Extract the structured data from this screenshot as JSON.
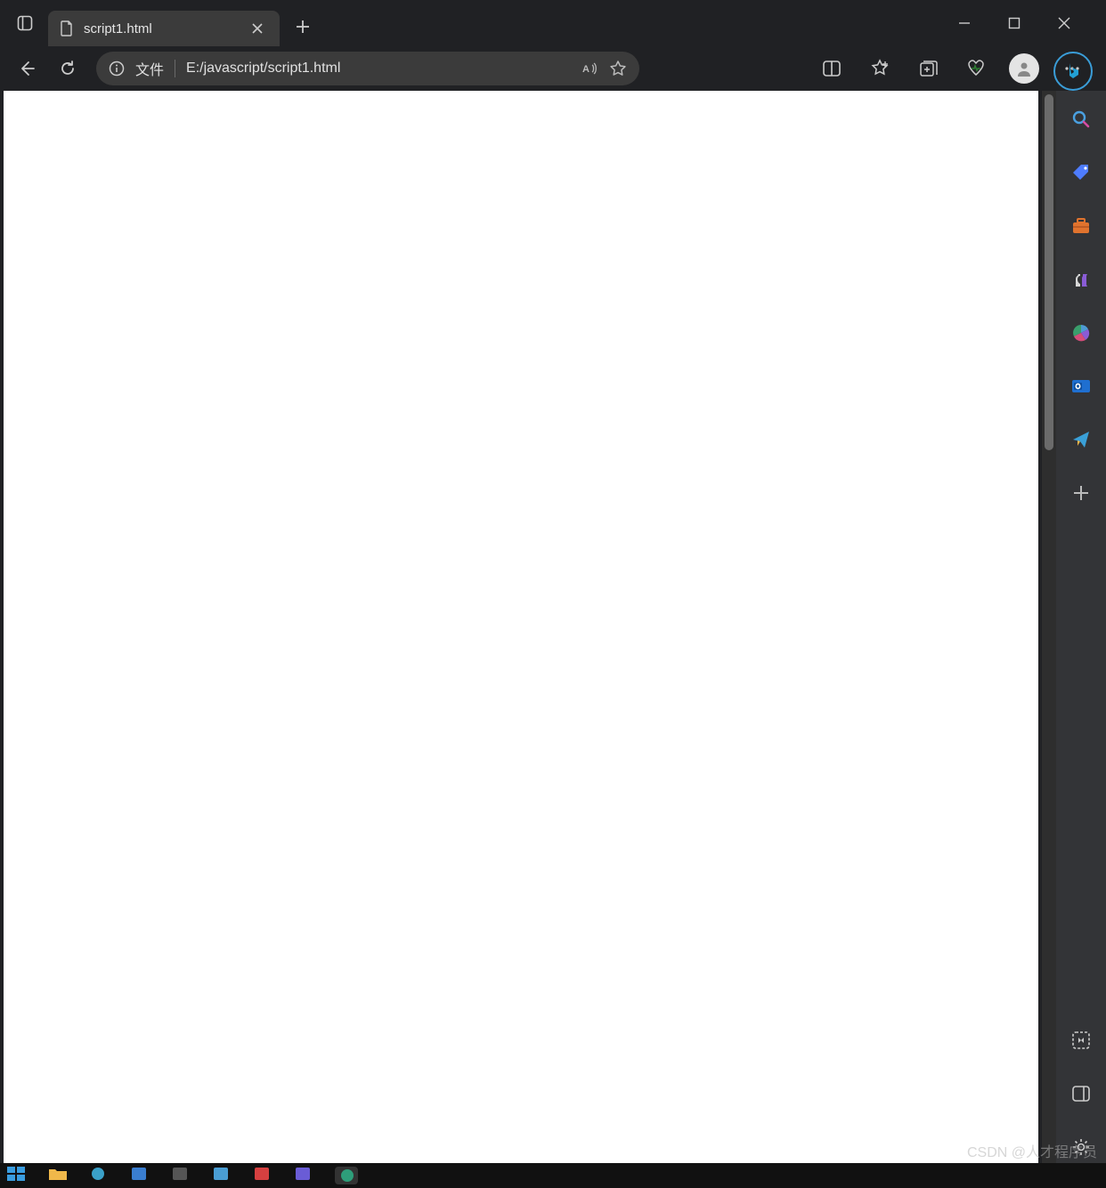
{
  "tab": {
    "title": "script1.html"
  },
  "addressbar": {
    "scheme_label": "文件",
    "path": "E:/javascript/script1.html"
  },
  "sidebar_icons": [
    "search",
    "shopping-tag",
    "briefcase",
    "games",
    "microsoft-365",
    "outlook",
    "send",
    "add"
  ],
  "sidebar_bottom_icons": [
    "screenshot",
    "split-screen",
    "settings"
  ],
  "watermark": "CSDN @人才程序员"
}
